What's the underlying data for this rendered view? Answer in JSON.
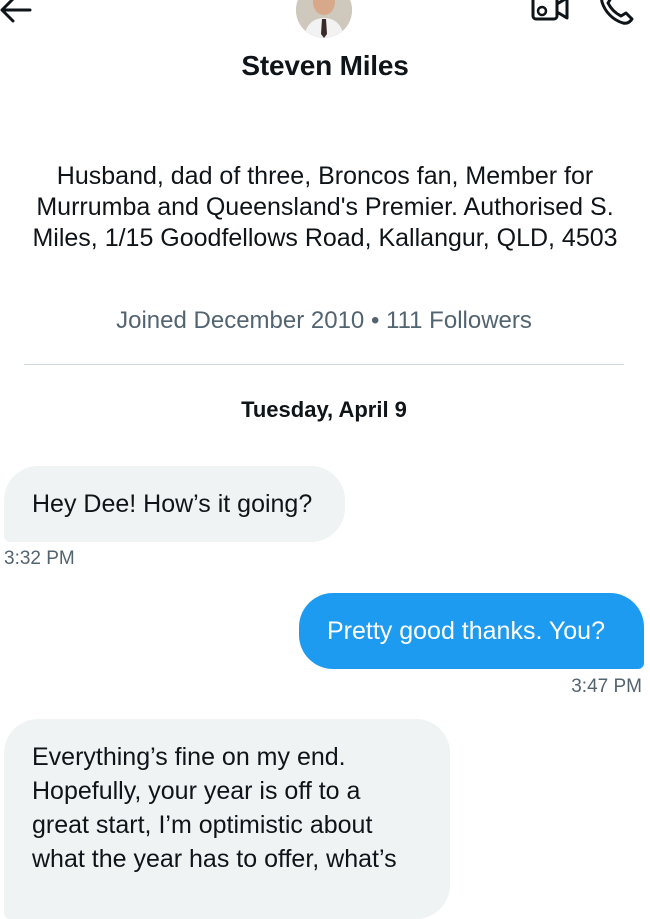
{
  "header": {
    "back_icon": "arrow-left-icon",
    "video_icon": "video-call-icon",
    "phone_icon": "phone-call-icon"
  },
  "profile": {
    "name": "Steven Miles",
    "bio": "Husband, dad of three, Broncos fan, Member for Murrumba and Queensland's Premier. Authorised S. Miles, 1/15 Goodfellows Road, Kallangur, QLD, 4503",
    "joined": "Joined December 2010",
    "separator": "•",
    "followers": "111 Followers"
  },
  "conversation": {
    "date_label": "Tuesday, April 9",
    "messages": [
      {
        "direction": "received",
        "text": "Hey Dee! How’s it going?",
        "time": "3:32 PM"
      },
      {
        "direction": "sent",
        "text": "Pretty good thanks. You?",
        "time": "3:47 PM"
      },
      {
        "direction": "received",
        "text": "Everything’s fine on my end. Hopefully, your year is off to a great start, I’m optimistic about what the year has to offer, what’s"
      }
    ]
  },
  "colors": {
    "accent": "#1d9bf0",
    "received_bubble": "#eff3f4",
    "secondary_text": "#536471",
    "primary_text": "#0f1419"
  }
}
